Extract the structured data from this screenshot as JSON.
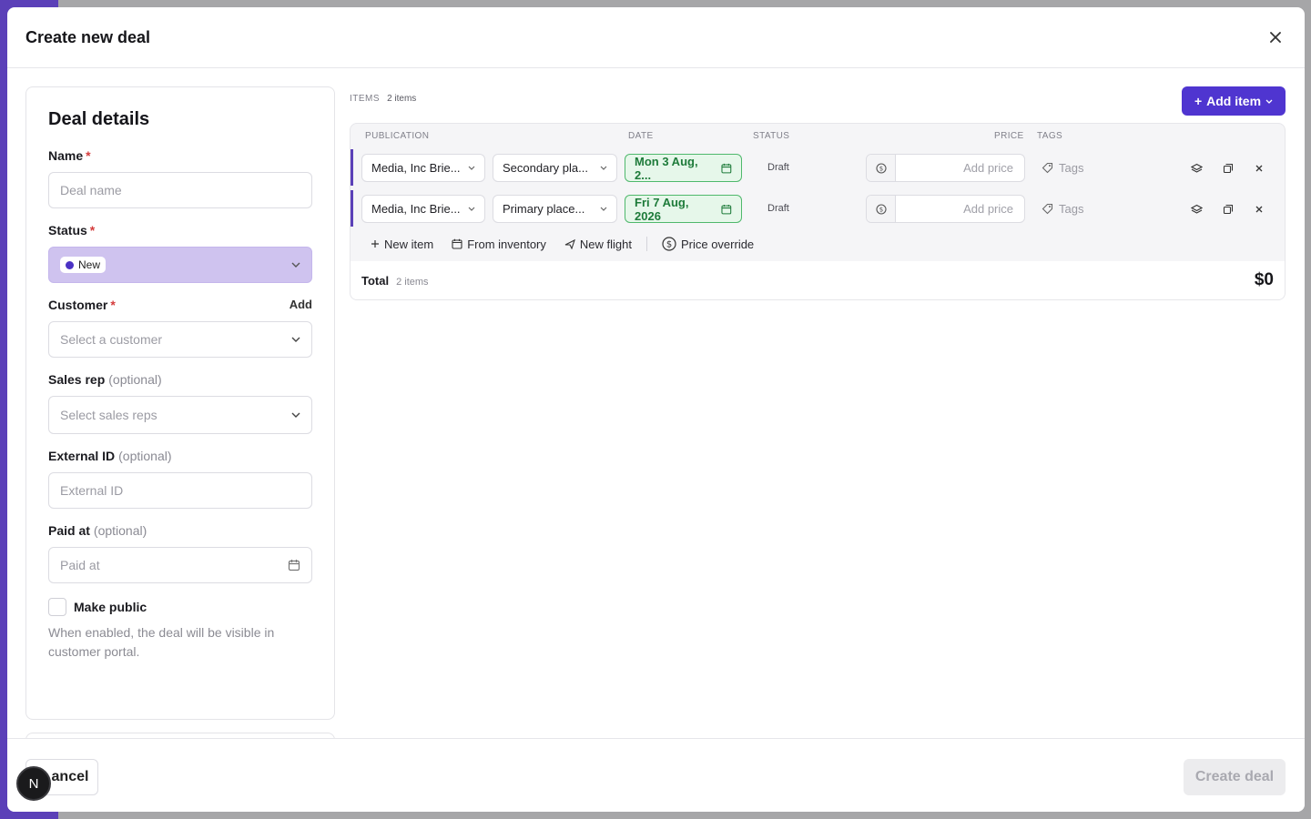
{
  "modal": {
    "title": "Create new deal"
  },
  "details": {
    "title": "Deal details",
    "name_label": "Name",
    "name_placeholder": "Deal name",
    "status_label": "Status",
    "status_value": "New",
    "customer_label": "Customer",
    "customer_add": "Add",
    "customer_placeholder": "Select a customer",
    "sales_rep_label": "Sales rep",
    "sales_rep_optional": "(optional)",
    "sales_rep_placeholder": "Select sales reps",
    "external_id_label": "External ID",
    "external_id_optional": "(optional)",
    "external_id_placeholder": "External ID",
    "paid_at_label": "Paid at",
    "paid_at_optional": "(optional)",
    "paid_at_placeholder": "Paid at",
    "make_public_label": "Make public",
    "make_public_helper": "When enabled, the deal will be visible in customer portal.",
    "required_mark": "*"
  },
  "items": {
    "label": "ITEMS",
    "count": "2 items",
    "add_item_label": "Add item",
    "columns": {
      "publication": "PUBLICATION",
      "date": "DATE",
      "status": "STATUS",
      "price": "PRICE",
      "tags": "TAGS"
    },
    "rows": [
      {
        "publication": "Media, Inc Brie...",
        "placement": "Secondary pla...",
        "date": "Mon 3 Aug, 2...",
        "status": "Draft",
        "price_placeholder": "Add price",
        "tags": "Tags"
      },
      {
        "publication": "Media, Inc Brie...",
        "placement": "Primary place...",
        "date": "Fri 7 Aug, 2026",
        "status": "Draft",
        "price_placeholder": "Add price",
        "tags": "Tags"
      }
    ],
    "actions": {
      "new_item": "New item",
      "from_inventory": "From inventory",
      "new_flight": "New flight",
      "price_override": "Price override"
    },
    "total_label": "Total",
    "total_count": "2 items",
    "total_value": "$0"
  },
  "footer": {
    "cancel_label": "ancel",
    "create_label": "Create deal",
    "badge_letter": "N"
  },
  "colors": {
    "accent": "#4f35d0",
    "status_bg": "#cfc3ef",
    "date_border": "#4fb86c",
    "date_bg": "#e6f7ea",
    "required": "#d43c3c"
  }
}
